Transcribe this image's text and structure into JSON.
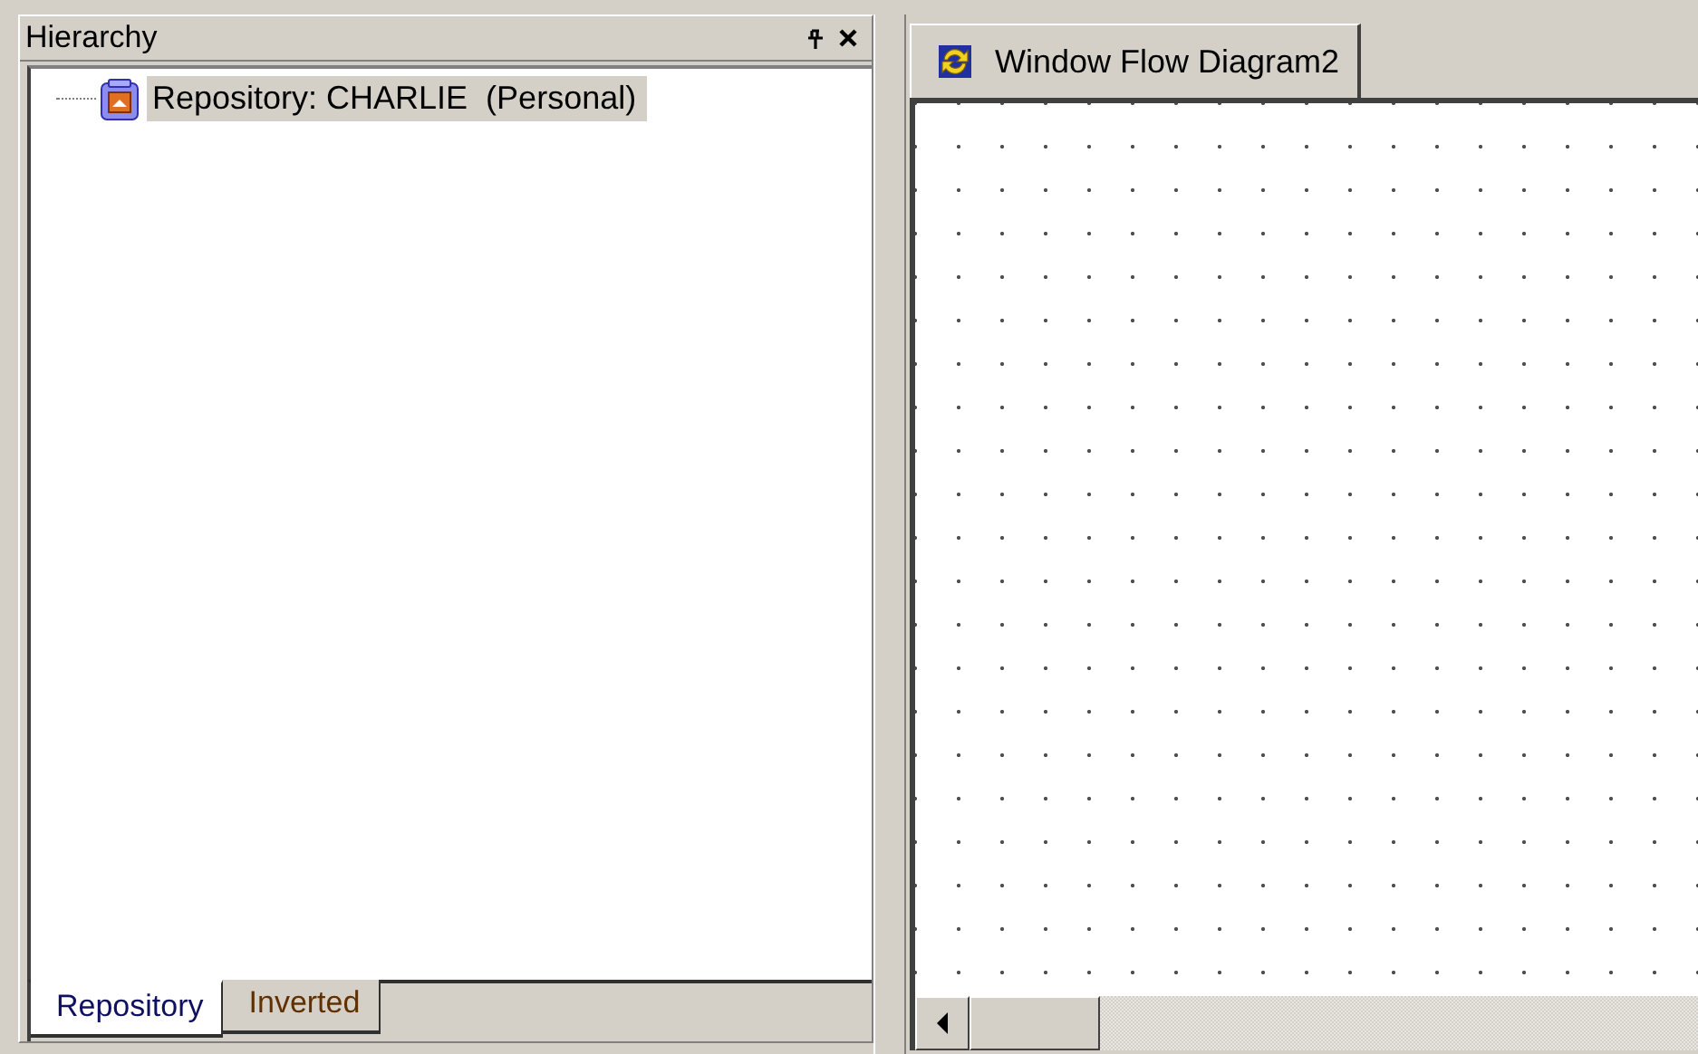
{
  "hierarchy": {
    "title": "Hierarchy",
    "tree": [
      {
        "label": "Repository: CHARLIE  (Personal)",
        "selected": true
      }
    ],
    "tabs": [
      {
        "label": "Repository",
        "selected": true
      },
      {
        "label": "Inverted",
        "selected": false
      }
    ]
  },
  "documents": {
    "tabs": [
      {
        "label": "Window Flow Diagram2",
        "selected": true
      }
    ]
  }
}
